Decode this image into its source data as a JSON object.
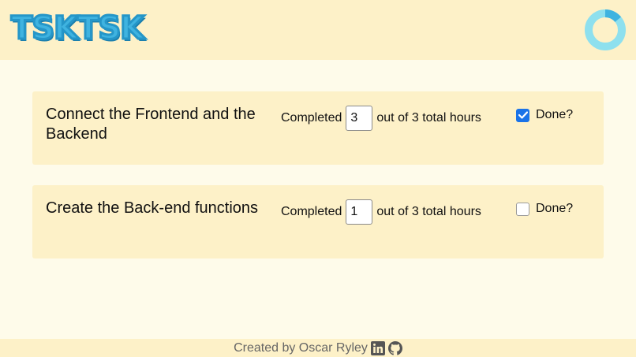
{
  "header": {
    "logo_text": "TSKTSK",
    "progress_ring": {
      "progress": 0.14,
      "track_color": "#8ee0ee",
      "fill_color": "#3fb3e0"
    }
  },
  "tasks": [
    {
      "title": "Connect the Frontend and the Backend",
      "completed_label": "Completed",
      "hours_value": "3",
      "total_label": "out of 3 total hours",
      "done_label": "Done?",
      "done": true
    },
    {
      "title": "Create the Back-end functions",
      "completed_label": "Completed",
      "hours_value": "1",
      "total_label": "out of 3 total hours",
      "done_label": "Done?",
      "done": false
    }
  ],
  "footer": {
    "credit": "Created by Oscar Ryley",
    "icons": [
      "linkedin-icon",
      "github-icon"
    ]
  },
  "colors": {
    "page_bg": "#fefbea",
    "panel_bg": "#fdf1c8",
    "accent": "#3fb3e0",
    "checkbox_checked": "#1a73e8"
  }
}
